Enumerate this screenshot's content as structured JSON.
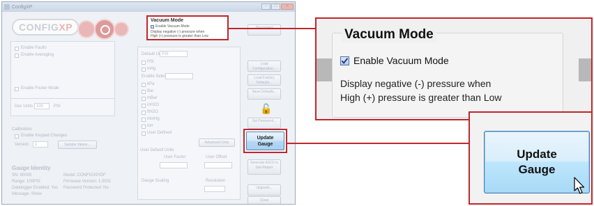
{
  "window": {
    "title": "ConfigXP",
    "logo_main": "CONFIG",
    "logo_accent": "XP",
    "controls": [
      "–",
      "□",
      "✕"
    ]
  },
  "left_panel": {
    "enable_faults": "Enable Faults",
    "enable_averaging": "Enable Averaging",
    "enable_footer_mode": "Enable Footer Mode",
    "decimals_label": "Dec Units",
    "decimals_value": "100",
    "decimals_unit": "PSI",
    "calibration_label": "Calibration",
    "enable_keypad": "Enable Keypad Changes",
    "version_label": "Version",
    "version_value": "1",
    "version_button": "Sample Values...",
    "identity_title": "Gauge Identity",
    "identity_rows": [
      "SN: 90000",
      "Range: 100PSI",
      "Datalogger Enabled: Yes",
      "Message: Show"
    ],
    "identity_rows_right": [
      "Model: CONFIGXP/DF",
      "Firmware Version: 1.0001",
      "Password Protected: No"
    ]
  },
  "center_panel": {
    "default_unit_label": "Default Unit",
    "default_unit_value": "PSI",
    "units": [
      "PSI",
      "inHg",
      "kPa",
      "Bar",
      "mBar",
      "inH2O",
      "ftH2O",
      "mmHg",
      "torr",
      "User Defined"
    ],
    "display_select_label": "Enable Selector",
    "user_default_units": "User Default Units",
    "user_factor": "User Factor",
    "user_offset": "User Offset",
    "gauge_scaling": "Gauge Scaling",
    "resolution": "Resolution",
    "more_button": "Advanced Units"
  },
  "right_buttons": [
    "Disconnect",
    "Load Configuration...",
    "Load Factory Defaults...",
    "Save Defaults...",
    "Set Password...",
    "Update Gauge",
    "Generate ASCII to Get Report",
    "Upgrade...",
    "Close"
  ],
  "vacuum": {
    "title": "Vacuum Mode",
    "checkbox_label": "Enable Vacuum Mode",
    "checkbox_checked": true,
    "description_line1": "Display negative (-) pressure when",
    "description_line2": "High (+) pressure is greater than Low"
  },
  "update_button": {
    "line1": "Update",
    "line2": "Gauge"
  },
  "colors": {
    "highlight": "#c0262c",
    "button_blue": "#a7d9f5",
    "check_blue": "#4d6fa3"
  }
}
